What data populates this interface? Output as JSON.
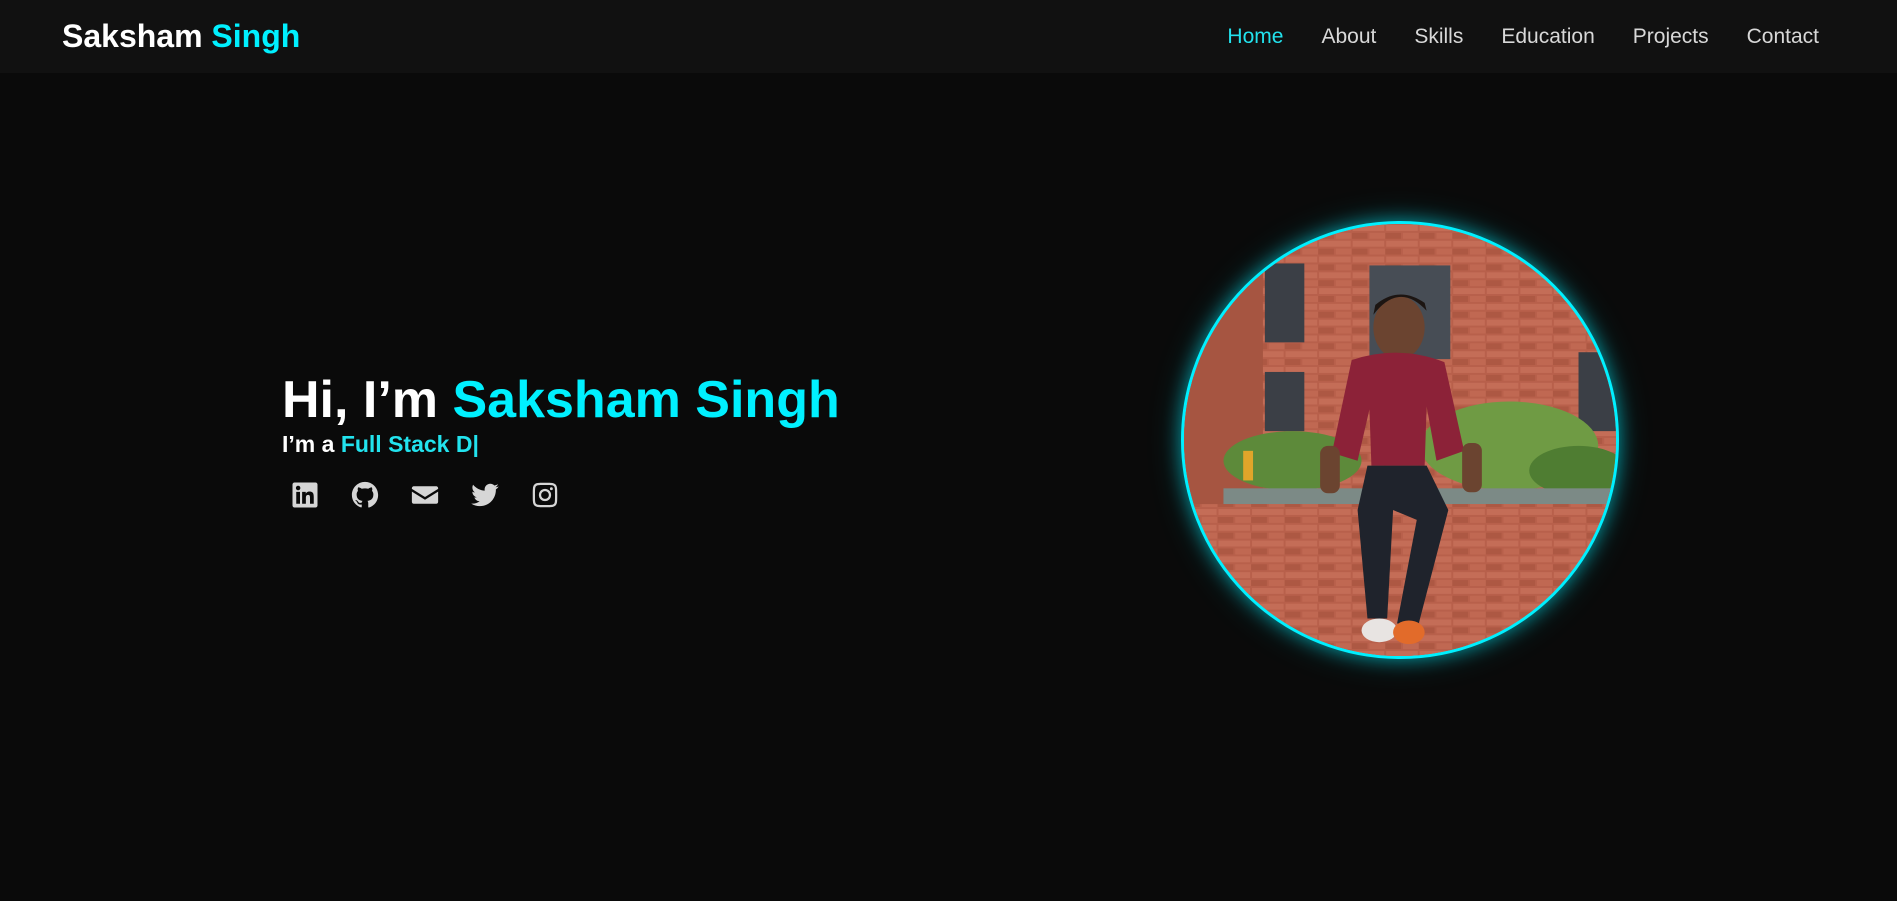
{
  "brand": {
    "first": "Saksham",
    "last": "Singh"
  },
  "nav": {
    "items": [
      {
        "label": "Home",
        "active": true
      },
      {
        "label": "About",
        "active": false
      },
      {
        "label": "Skills",
        "active": false
      },
      {
        "label": "Education",
        "active": false
      },
      {
        "label": "Projects",
        "active": false
      },
      {
        "label": "Contact",
        "active": false
      }
    ]
  },
  "hero": {
    "greeting": "Hi, I’m",
    "name": "Saksham Singh",
    "role_prefix": "I’m a",
    "role_typed": "Full Stack D|"
  },
  "socials": [
    {
      "icon": "linkedin-icon"
    },
    {
      "icon": "github-icon"
    },
    {
      "icon": "mail-icon"
    },
    {
      "icon": "twitter-icon"
    },
    {
      "icon": "instagram-icon"
    }
  ],
  "profile_photo": {
    "icon": "profile-photo"
  },
  "colors": {
    "accent": "#00f0ff",
    "background": "#0a0a0a",
    "navbar": "#111111",
    "text": "#ffffff"
  }
}
